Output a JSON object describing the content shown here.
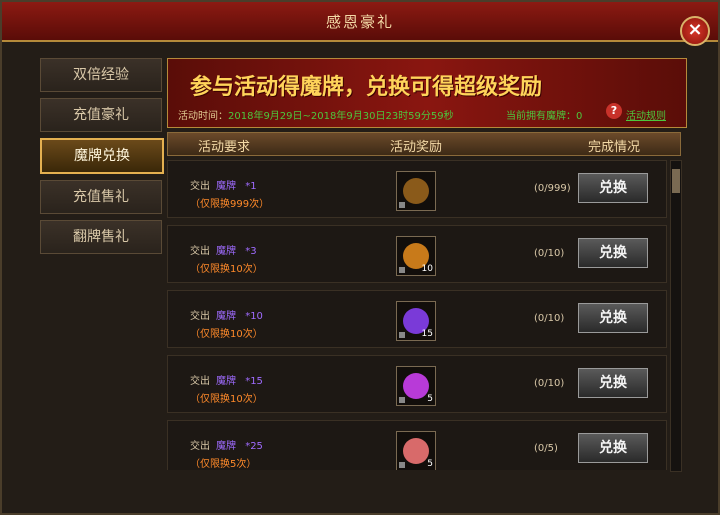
{
  "window": {
    "title": "感恩豪礼",
    "close_label": "×"
  },
  "sidebar": {
    "items": [
      {
        "label": "双倍经验"
      },
      {
        "label": "充值豪礼"
      },
      {
        "label": "魔牌兑换",
        "active": true
      },
      {
        "label": "充值售礼"
      },
      {
        "label": "翻牌售礼"
      }
    ]
  },
  "banner": {
    "headline": "参与活动得魔牌，兑换可得超级奖励",
    "time_label": "活动时间：",
    "time_value": "2018年9月29日~2018年9月30日23时59分59秒",
    "owned_label": "当前拥有魔牌：",
    "owned_value": "0",
    "rules_label": "活动规则"
  },
  "columns": {
    "requirement": "活动要求",
    "reward": "活动奖励",
    "status": "完成情况"
  },
  "rows": [
    {
      "give": "交出",
      "item": "魔牌",
      "qty": "*1",
      "limit": "（仅限换999次）",
      "reward_count": "",
      "progress": "(0/999)",
      "button": "兑换",
      "color": "#8a5a1a"
    },
    {
      "give": "交出",
      "item": "魔牌",
      "qty": "*3",
      "limit": "（仅限换10次）",
      "reward_count": "10",
      "progress": "(0/10)",
      "button": "兑换",
      "color": "#c87a1a"
    },
    {
      "give": "交出",
      "item": "魔牌",
      "qty": "*10",
      "limit": "（仅限换10次）",
      "reward_count": "15",
      "progress": "(0/10)",
      "button": "兑换",
      "color": "#7a3ad8"
    },
    {
      "give": "交出",
      "item": "魔牌",
      "qty": "*15",
      "limit": "（仅限换10次）",
      "reward_count": "5",
      "progress": "(0/10)",
      "button": "兑换",
      "color": "#b83ad8"
    },
    {
      "give": "交出",
      "item": "魔牌",
      "qty": "*25",
      "limit": "（仅限换5次）",
      "reward_count": "5",
      "progress": "(0/5)",
      "button": "兑换",
      "color": "#d86a6a"
    }
  ]
}
